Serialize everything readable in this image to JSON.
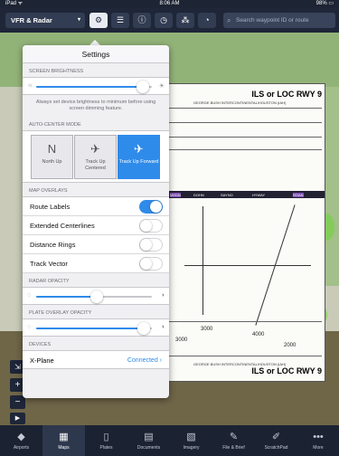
{
  "status_bar": {
    "left": "iPad ᯤ",
    "time": "8:06 AM",
    "battery": "98% ▭"
  },
  "toolbar": {
    "layer_selector": "VFR & Radar",
    "layer_chevron": "▾",
    "icons": [
      "gear-icon",
      "list-icon",
      "info-icon",
      "clock-icon",
      "pin-icon",
      "timer-icon"
    ],
    "search_placeholder": "Search waypoint ID or route"
  },
  "settings": {
    "title": "Settings",
    "screen_brightness": {
      "header": "SCREEN BRIGHTNESS",
      "value": 0.92,
      "note": "Always set device brightness to minimum before using screen dimming feature."
    },
    "auto_center": {
      "header": "AUTO-CENTER MODE",
      "modes": [
        {
          "label": "North Up",
          "icon": "N",
          "active": false
        },
        {
          "label": "Track Up Centered",
          "icon": "✈",
          "active": false
        },
        {
          "label": "Track Up Forward",
          "icon": "✈",
          "active": true
        }
      ]
    },
    "map_overlays": {
      "header": "MAP OVERLAYS",
      "items": [
        {
          "label": "Route Labels",
          "on": true
        },
        {
          "label": "Extended Centerlines",
          "on": false
        },
        {
          "label": "Distance Rings",
          "on": false
        },
        {
          "label": "Track Vector",
          "on": false
        }
      ]
    },
    "radar_opacity": {
      "header": "RADAR OPACITY",
      "value": 0.52
    },
    "plate_opacity": {
      "header": "PLATE OVERLAY OPACITY",
      "value": 0.93
    },
    "devices": {
      "header": "DEVICES",
      "items": [
        {
          "label": "X-Plane",
          "status": "Connected ›"
        }
      ]
    }
  },
  "plate": {
    "title_top": "ILS or LOC RWY 9",
    "title_bottom": "ILS or LOC RWY 9",
    "subtitle": "GEORGE BUSH INTERCONTINENTAL/HOUSTON (IAH)",
    "fixes": [
      "MEDN",
      "DOHN",
      "SAYNO",
      "HYWAY",
      "ROAN"
    ],
    "altitudes": [
      "3000",
      "4000",
      "2000",
      "3000"
    ]
  },
  "map_controls": {
    "zoom_in": "+",
    "zoom_out": "−",
    "play": "▶"
  },
  "tabs": [
    {
      "label": "Airports",
      "icon": "◆",
      "active": false
    },
    {
      "label": "Maps",
      "icon": "▦",
      "active": true
    },
    {
      "label": "Plates",
      "icon": "▯",
      "active": false
    },
    {
      "label": "Documents",
      "icon": "▤",
      "active": false
    },
    {
      "label": "Imagery",
      "icon": "▧",
      "active": false
    },
    {
      "label": "File & Brief",
      "icon": "✎",
      "active": false
    },
    {
      "label": "ScratchPad",
      "icon": "✐",
      "active": false
    },
    {
      "label": "More",
      "icon": "•••",
      "active": false
    }
  ],
  "colors": {
    "accent": "#2f8bea",
    "toolbar": "#1e2638",
    "tabbar": "#1b2232"
  }
}
